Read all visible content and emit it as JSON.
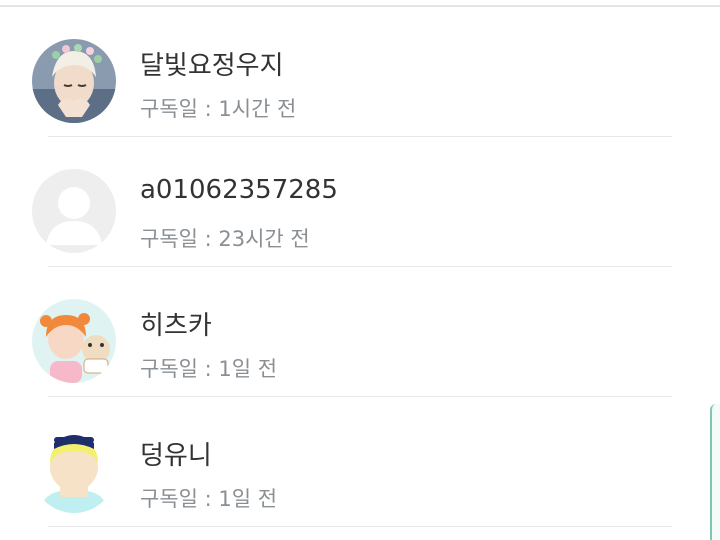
{
  "subscribers": [
    {
      "name": "달빛요정우지",
      "subscribed_label": "구독일 : 1시간 전",
      "avatar": "photo-flower-crown"
    },
    {
      "name": "a01062357285",
      "subscribed_label": "구독일 : 23시간 전",
      "avatar": "default-silhouette"
    },
    {
      "name": "히츠카",
      "subscribed_label": "구독일 : 1일 전",
      "avatar": "photo-hamster"
    },
    {
      "name": "덩유니",
      "subscribed_label": "구독일 : 1일 전",
      "avatar": "illustration-yellow-hair"
    }
  ]
}
